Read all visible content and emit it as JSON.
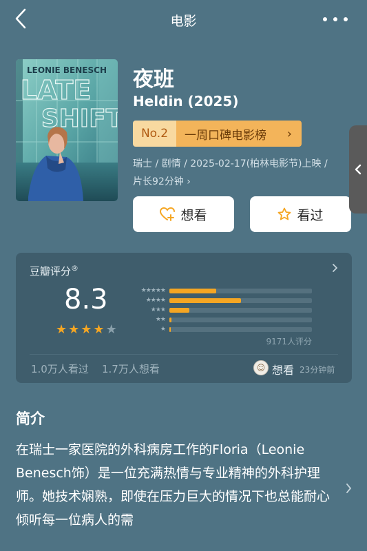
{
  "nav": {
    "title": "电影",
    "back_icon": "chevron-left-icon",
    "more_icon": "more-dots-icon"
  },
  "poster": {
    "line1": "LEONIE BENESCH",
    "line2": "LATE",
    "line3": "SHIFT"
  },
  "movie": {
    "title": "夜班",
    "original_title": "Heldin (2025)",
    "rank_no": "No.2",
    "rank_list": "一周口碑电影榜",
    "meta_line1": "瑞士 / 剧情 / 2025-02-17(柏林电影节)上映 /",
    "meta_line2": "片长92分钟"
  },
  "actions": {
    "want_label": "想看",
    "seen_label": "看过"
  },
  "rating": {
    "source_label": "豆瓣评分",
    "registered_mark": "®",
    "score": "8.3",
    "stars_filled": 4,
    "stars_total": 5,
    "distribution_percent": [
      33,
      50,
      14,
      1.5,
      0.5
    ],
    "count_text": "9171人评分",
    "seen_count_text": "1.0万人看过",
    "want_count_text": "1.7万人想看",
    "activity_label": "想看",
    "activity_time": "23分钟前"
  },
  "synopsis": {
    "title": "简介",
    "text": "在瑞士一家医院的外科病房工作的Floria（Leonie Benesch饰）是一位充满热情与专业精神的外科护理师。她技术娴熟，即使在压力巨大的情况下也总能耐心倾听每一位病人的需"
  },
  "colors": {
    "background": "#4f7384",
    "card": "#3f5d6c",
    "accent": "#f5a623",
    "rank_badge": "#f3b45a"
  }
}
